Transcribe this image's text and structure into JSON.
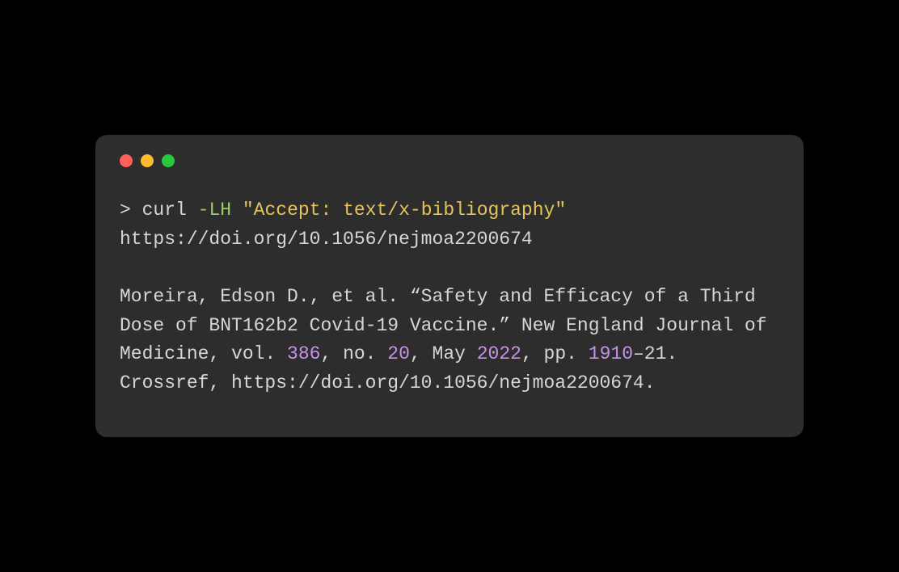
{
  "terminal": {
    "prompt": "> ",
    "command": "curl",
    "flag": "-LH",
    "header_arg": "\"Accept: text/x-bibliography\"",
    "url_line": "https://doi.org/10.1056/nejmoa2200674",
    "output": {
      "seg1": "Moreira, Edson D., et al. “Safety and Efficacy of a Third Dose of BNT162b2 Covid-19 Vaccine.” New England Journal of Medicine, vol. ",
      "vol": "386",
      "seg2": ", no. ",
      "issue": "20",
      "seg3": ", May ",
      "year": "2022",
      "seg4": ", pp. ",
      "page_start": "1910",
      "seg5": "–21. Crossref, https://doi.org/10.1056/nejmoa2200674."
    }
  }
}
